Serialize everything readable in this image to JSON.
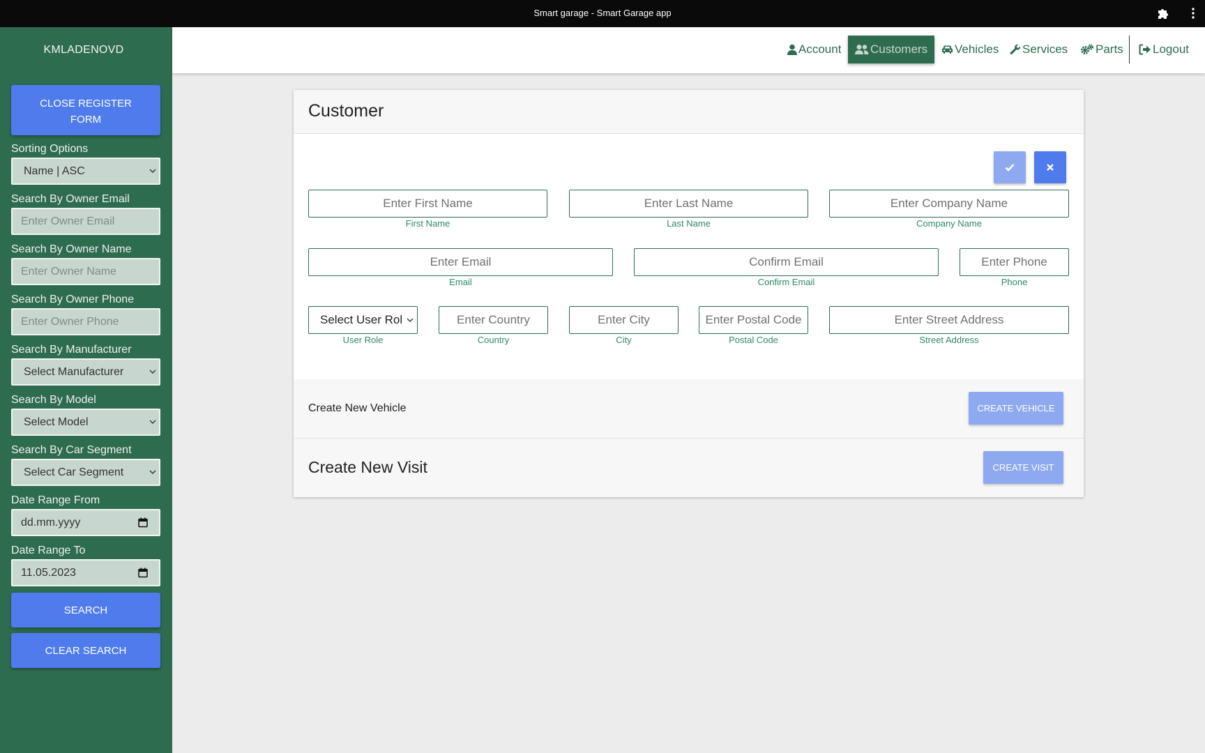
{
  "window": {
    "title": "Smart garage - Smart Garage app"
  },
  "sidebar": {
    "username": "KMLADENOVD",
    "close_register_label": "CLOSE REGISTER FORM",
    "sorting": {
      "label": "Sorting Options",
      "value": "Name | ASC"
    },
    "owner_email": {
      "label": "Search By Owner Email",
      "placeholder": "Enter Owner Email"
    },
    "owner_name": {
      "label": "Search By Owner Name",
      "placeholder": "Enter Owner Name"
    },
    "owner_phone": {
      "label": "Search By Owner Phone",
      "placeholder": "Enter Owner Phone"
    },
    "manufacturer": {
      "label": "Search By Manufacturer",
      "value": "Select Manufacturer"
    },
    "model": {
      "label": "Search By Model",
      "value": "Select Model"
    },
    "car_segment": {
      "label": "Search By Car Segment",
      "value": "Select Car Segment"
    },
    "date_from": {
      "label": "Date Range From",
      "value": "dd.mm.yyyy"
    },
    "date_to": {
      "label": "Date Range To",
      "value": "11.05.2023"
    },
    "search_label": "SEARCH",
    "clear_label": "CLEAR SEARCH"
  },
  "nav": {
    "account": "Account",
    "customers": "Customers",
    "vehicles": "Vehicles",
    "services": "Services",
    "parts": "Parts",
    "logout": "Logout",
    "active": "Customers"
  },
  "form": {
    "title": "Customer",
    "first_name": {
      "placeholder": "Enter First Name",
      "label": "First Name"
    },
    "last_name": {
      "placeholder": "Enter Last Name",
      "label": "Last Name"
    },
    "company_name": {
      "placeholder": "Enter Company Name",
      "label": "Company Name"
    },
    "email": {
      "placeholder": "Enter Email",
      "label": "Email"
    },
    "confirm_email": {
      "placeholder": "Confirm Email",
      "label": "Confirm Email"
    },
    "phone": {
      "placeholder": "Enter Phone",
      "label": "Phone"
    },
    "user_role": {
      "value": "Select User Rol",
      "label": "User Role"
    },
    "country": {
      "placeholder": "Enter Country",
      "label": "Country"
    },
    "city": {
      "placeholder": "Enter City",
      "label": "City"
    },
    "postal_code": {
      "placeholder": "Enter Postal Code",
      "label": "Postal Code"
    },
    "street_address": {
      "placeholder": "Enter Street Address",
      "label": "Street Address"
    },
    "vehicle_section": {
      "title": "Create New Vehicle",
      "button": "CREATE VEHICLE"
    },
    "visit_section": {
      "title": "Create New Visit",
      "button": "CREATE VISIT"
    }
  },
  "colors": {
    "sidebar_bg": "#2e6c50",
    "accent_blue": "#4f7bed",
    "light_blue": "#8ea9ef",
    "field_border": "#2e6c50",
    "label_green": "#2e8a66"
  }
}
